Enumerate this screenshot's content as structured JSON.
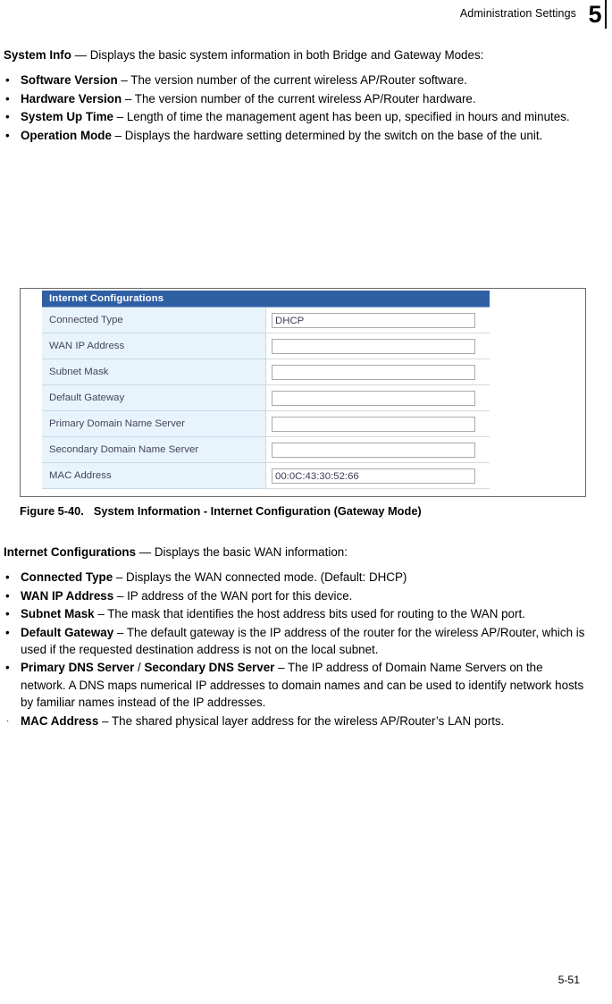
{
  "header": {
    "title": "Administration Settings",
    "chapter_number": "5"
  },
  "footer": {
    "page_number": "5-51"
  },
  "upper_section": {
    "intro_term": "System Info",
    "intro_rest": " — Displays the basic system information in both Bridge and Gateway Modes:",
    "bullets": [
      {
        "marker": "•",
        "term": "Software Version",
        "rest": " – The version number of the current wireless AP/Router software."
      },
      {
        "marker": "•",
        "term": "Hardware Version",
        "rest": " – The version number of the current wireless AP/Router hardware."
      },
      {
        "marker": "•",
        "term": "System Up Time",
        "rest": " – Length of time the management agent has been up, specified in hours and minutes."
      },
      {
        "marker": "•",
        "term": "Operation Mode",
        "rest": " – Displays the hardware setting determined by the switch on the base of the unit."
      }
    ]
  },
  "figure": {
    "caption_number": "Figure 5-40.",
    "caption_text": "System Information - Internet Configuration (Gateway Mode)",
    "panel": {
      "header_label": "Internet Configurations",
      "header_bg": "#2e5fa3",
      "label_bg": "#e8f4fc",
      "rows": [
        {
          "label": "Connected Type",
          "value": "DHCP"
        },
        {
          "label": "WAN IP Address",
          "value": ""
        },
        {
          "label": "Subnet Mask",
          "value": ""
        },
        {
          "label": "Default Gateway",
          "value": ""
        },
        {
          "label": "Primary Domain Name Server",
          "value": ""
        },
        {
          "label": "Secondary Domain Name Server",
          "value": ""
        },
        {
          "label": "MAC Address",
          "value": "00:0C:43:30:52:66"
        }
      ]
    }
  },
  "lower_section": {
    "intro_term": "Internet Configurations",
    "intro_rest": " — Displays the basic WAN information:",
    "bullets": [
      {
        "marker": "•",
        "term": "Connected Type",
        "rest": " – Displays the WAN connected mode. (Default: DHCP)"
      },
      {
        "marker": "•",
        "term": "WAN IP Address",
        "rest": " – IP address of the WAN port for this device."
      },
      {
        "marker": "•",
        "term": "Subnet Mask",
        "rest": " – The mask that identifies the host address bits used for routing to the WAN port."
      },
      {
        "marker": "•",
        "term": "Default Gateway",
        "rest": " – The default gateway is the IP address of the router for the wireless AP/Router, which is used if the requested destination address is not on the local subnet."
      },
      {
        "marker": "•",
        "term": "Primary DNS Server",
        "term2_separator": " / ",
        "term2": "Secondary DNS Server",
        "rest": " – The IP address of Domain Name Servers on the network. A DNS maps numerical IP addresses to domain names and can be used to identify network hosts by familiar names instead of the IP addresses."
      },
      {
        "marker": "·",
        "term": "MAC Address",
        "rest": " – The shared physical layer address for the wireless AP/Router’s LAN ports."
      }
    ]
  }
}
